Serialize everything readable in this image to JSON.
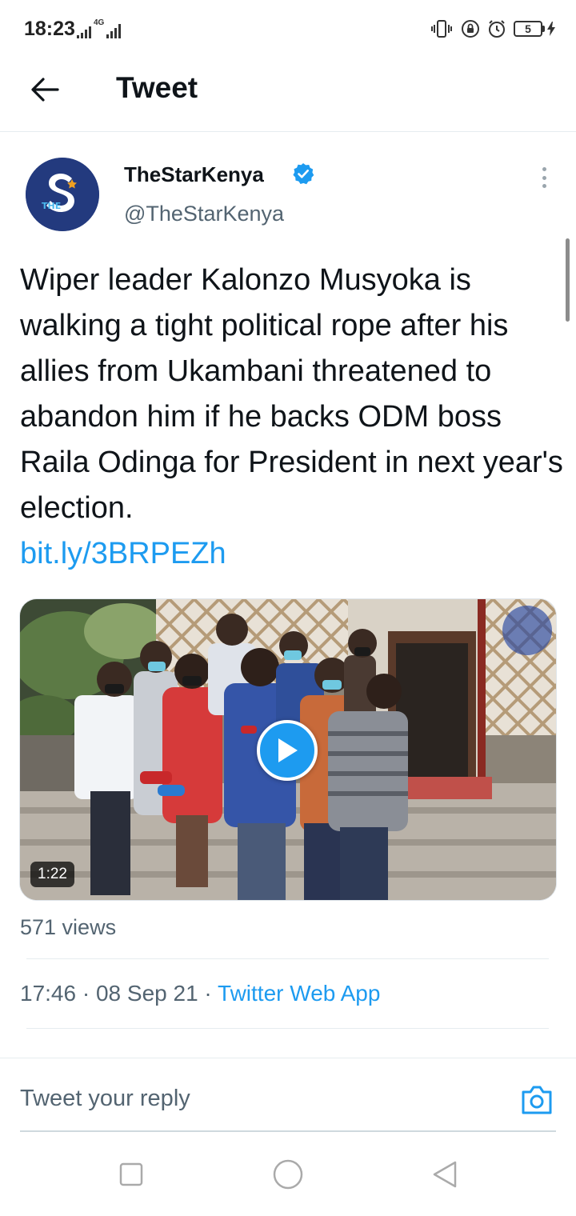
{
  "status_bar": {
    "time": "18:23",
    "network_label": "4G",
    "battery_level": "5"
  },
  "header": {
    "title": "Tweet"
  },
  "tweet": {
    "author_name": "TheStarKenya",
    "author_handle": "@TheStarKenya",
    "avatar_text": "THE",
    "text": "Wiper leader Kalonzo Musyoka is walking a tight political rope after his allies from Ukambani threatened to abandon him if he backs ODM boss Raila Odinga for President in next year's election.",
    "link": "bit.ly/3BRPEZh",
    "video_duration": "1:22",
    "views": "571 views",
    "time": "17:46",
    "separator": "·",
    "date": "08 Sep 21",
    "source": "Twitter Web App"
  },
  "reply": {
    "placeholder": "Tweet your reply"
  },
  "colors": {
    "accent": "#1d9bf0",
    "text_primary": "#0f1419",
    "text_secondary": "#536471",
    "avatar_bg": "#233a7e"
  }
}
